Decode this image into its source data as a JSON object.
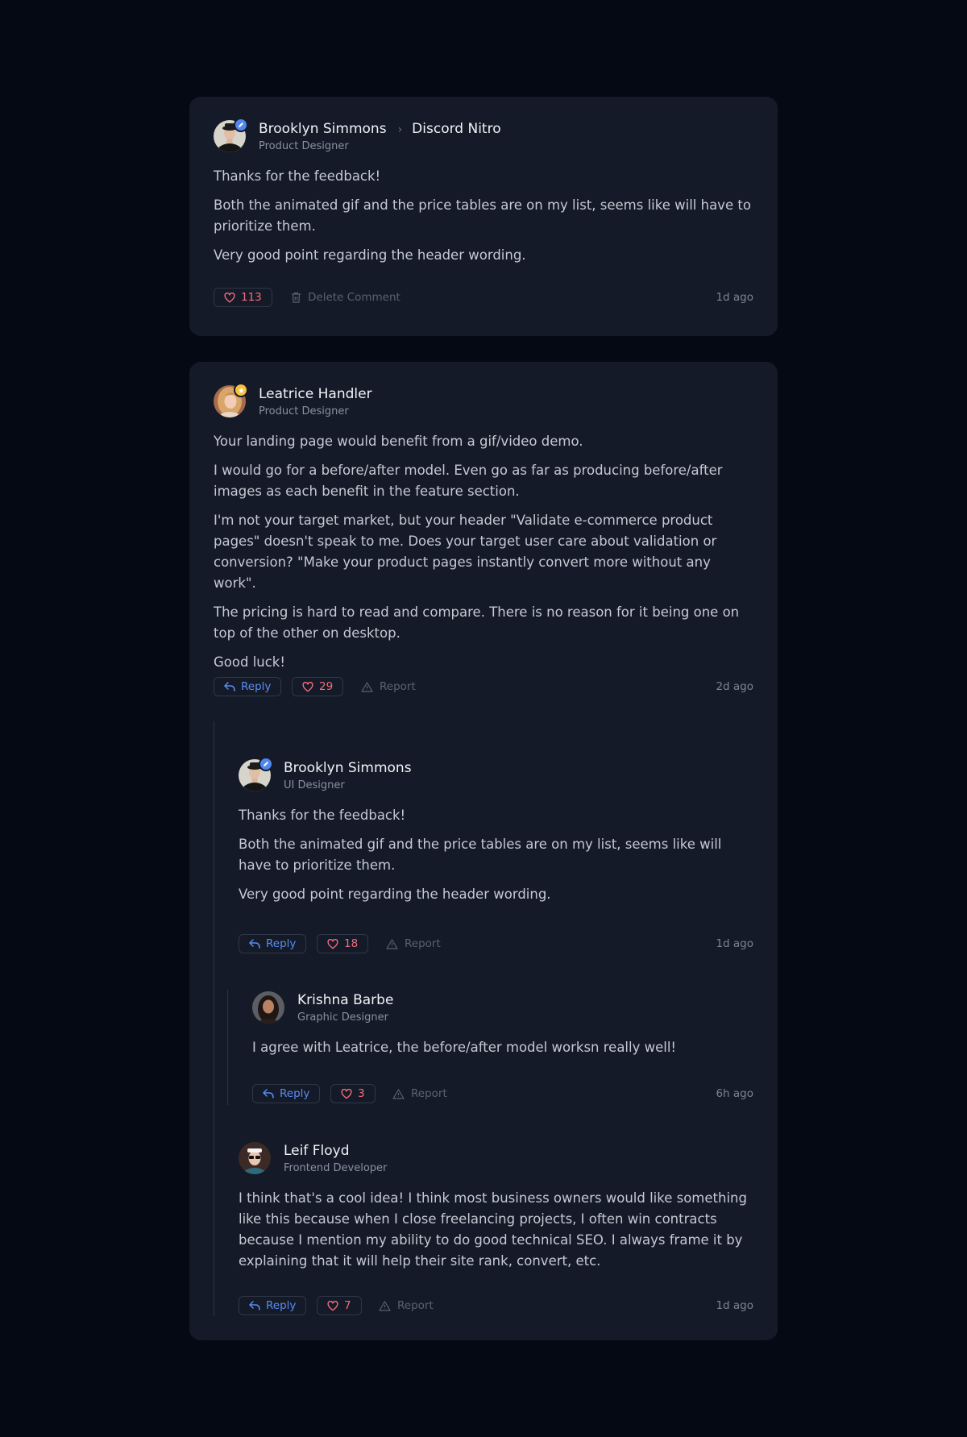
{
  "colors": {
    "background": "#050913",
    "card": "#141a27",
    "accent_blue": "#5a8cf0",
    "like_red": "#f26d7d",
    "badge_gold": "#f4c142"
  },
  "comments": [
    {
      "name": "Brooklyn Simmons",
      "target": "Discord Nitro",
      "role": "Product Designer",
      "badge": "pen-icon",
      "paragraphs": [
        "Thanks for the feedback!",
        "Both the animated gif and the price tables are on my list, seems like will have to prioritize them.",
        "Very good point regarding the header wording."
      ],
      "likes": "113",
      "secondary_action": "Delete Comment",
      "time": "1d ago"
    },
    {
      "name": "Leatrice Handler",
      "role": "Product Designer",
      "badge": "star-icon",
      "paragraphs": [
        "Your landing page would benefit from a gif/video demo.",
        "I would go for a before/after model. Even go as far as producing before/after images as each benefit in the feature section.",
        "I'm not your target market, but your header \"Validate e-commerce product pages\" doesn't speak to me. Does your target user care about validation or conversion? \"Make your product pages instantly convert more without any work\".",
        "The pricing is hard to read and compare. There is no reason for it being one on top of the other on desktop.",
        "Good luck!"
      ],
      "reply_label": "Reply",
      "likes": "29",
      "secondary_action": "Report",
      "time": "2d ago"
    },
    {
      "name": "Brooklyn Simmons",
      "role": "UI Designer",
      "badge": "pen-icon",
      "paragraphs": [
        "Thanks for the feedback!",
        "Both the animated gif and the price tables are on my list, seems like will have to prioritize them.",
        "Very good point regarding the header wording."
      ],
      "reply_label": "Reply",
      "likes": "18",
      "secondary_action": "Report",
      "time": "1d ago"
    },
    {
      "name": "Krishna Barbe",
      "role": "Graphic Designer",
      "paragraphs": [
        "I agree with Leatrice, the before/after model worksn really well!"
      ],
      "reply_label": "Reply",
      "likes": "3",
      "secondary_action": "Report",
      "time": "6h ago"
    },
    {
      "name": "Leif Floyd",
      "role": "Frontend Developer",
      "paragraphs": [
        "I think that's a cool idea! I think most business owners would like something like this because when I close freelancing projects, I often win contracts because I mention my ability to do good technical SEO. I always frame it by explaining that it will help their site rank, convert, etc."
      ],
      "reply_label": "Reply",
      "likes": "7",
      "secondary_action": "Report",
      "time": "1d ago"
    }
  ]
}
